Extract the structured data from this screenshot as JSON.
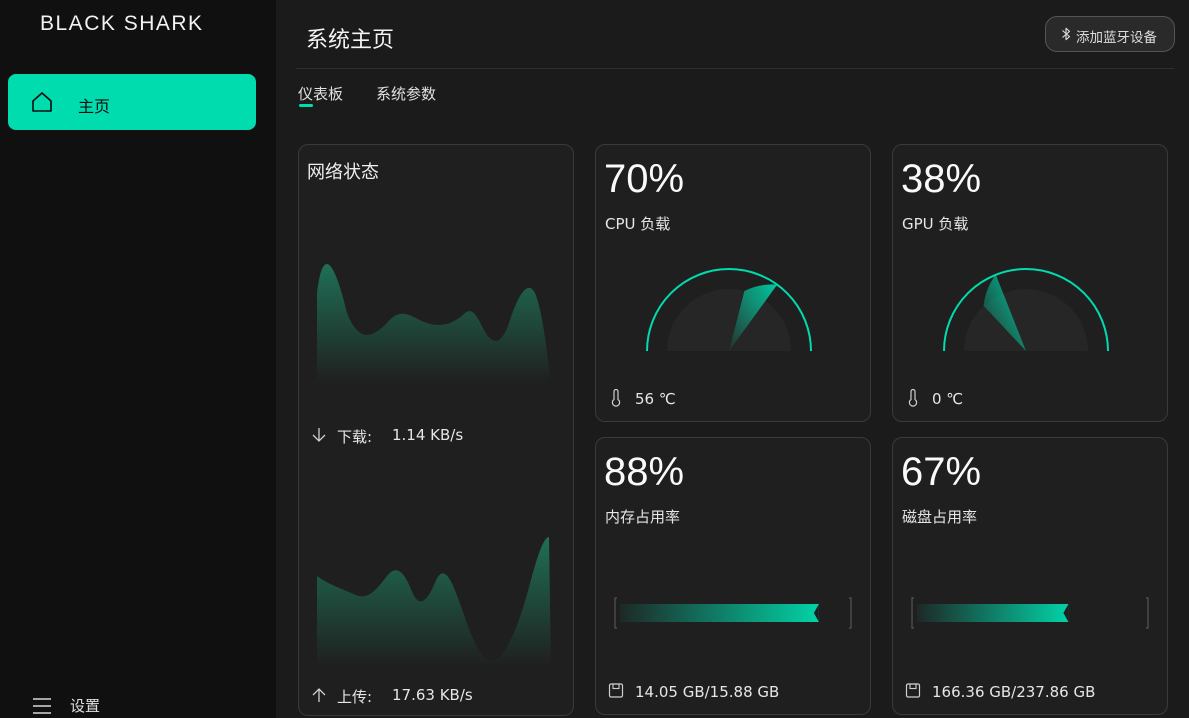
{
  "brand": "BLACK SHARK",
  "sidebar": {
    "home_label": "主页",
    "settings_label": "设置"
  },
  "header": {
    "title": "系统主页",
    "bluetooth_button": "添加蓝牙设备"
  },
  "tabs": {
    "dashboard": "仪表板",
    "params": "系统参数",
    "active": "dashboard"
  },
  "network": {
    "title": "网络状态",
    "download_label": "下载:",
    "download_value": "1.14 KB/s",
    "upload_label": "上传:",
    "upload_value": "17.63 KB/s"
  },
  "cpu": {
    "percent": "70%",
    "label": "CPU 负载",
    "temp": "56 ℃",
    "load": 0.7
  },
  "gpu": {
    "percent": "38%",
    "label": "GPU 负载",
    "temp": "0 ℃",
    "load": 0.38
  },
  "memory": {
    "percent": "88%",
    "label": "内存占用率",
    "usage": "14.05 GB/15.88 GB",
    "ratio": 0.88
  },
  "disk": {
    "percent": "67%",
    "label": "磁盘占用率",
    "usage": "166.36 GB/237.86 GB",
    "ratio": 0.67
  },
  "colors": {
    "accent": "#00dcae",
    "background": "#1b1b1b",
    "sidebar": "#101010",
    "card": "#1f1f1f"
  }
}
